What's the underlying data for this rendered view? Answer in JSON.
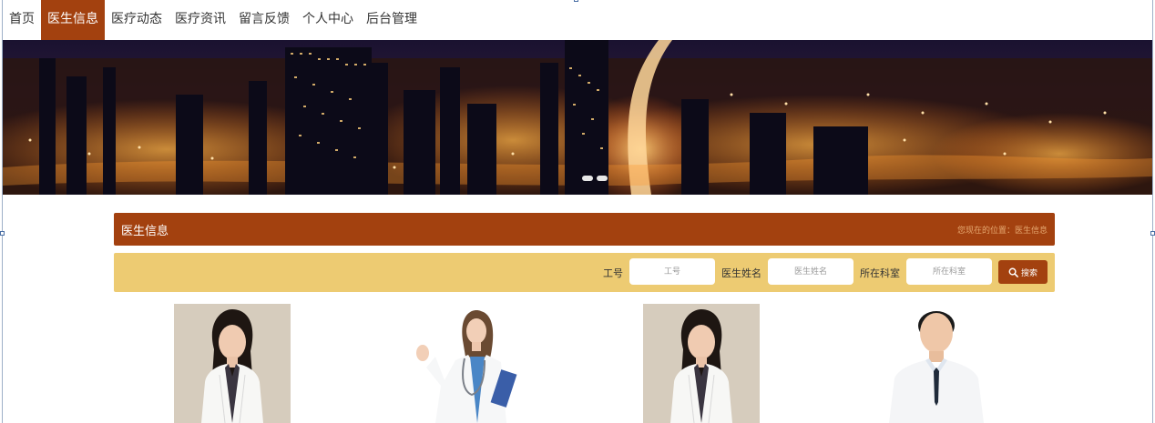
{
  "nav": {
    "items": [
      {
        "label": "首页",
        "active": false
      },
      {
        "label": "医生信息",
        "active": true
      },
      {
        "label": "医疗动态",
        "active": false
      },
      {
        "label": "医疗资讯",
        "active": false
      },
      {
        "label": "留言反馈",
        "active": false
      },
      {
        "label": "个人中心",
        "active": false
      },
      {
        "label": "后台管理",
        "active": false
      }
    ]
  },
  "section": {
    "title": "医生信息",
    "breadcrumb": "您现在的位置：医生信息"
  },
  "search": {
    "fields": [
      {
        "label": "工号",
        "placeholder": "工号"
      },
      {
        "label": "医生姓名",
        "placeholder": "医生姓名"
      },
      {
        "label": "所在科室",
        "placeholder": "所在科室"
      }
    ],
    "button_label": "搜索",
    "button_icon": "search-icon"
  },
  "colors": {
    "accent": "#a3410f",
    "search_bar": "#edcb72",
    "breadcrumb": "#e6a870"
  },
  "doctor_cards": [
    {
      "photo": "female-doctor-photo"
    },
    {
      "photo": "female-doctor-clipboard-photo"
    },
    {
      "photo": "female-doctor-photo"
    },
    {
      "photo": "male-doctor-photo"
    }
  ]
}
